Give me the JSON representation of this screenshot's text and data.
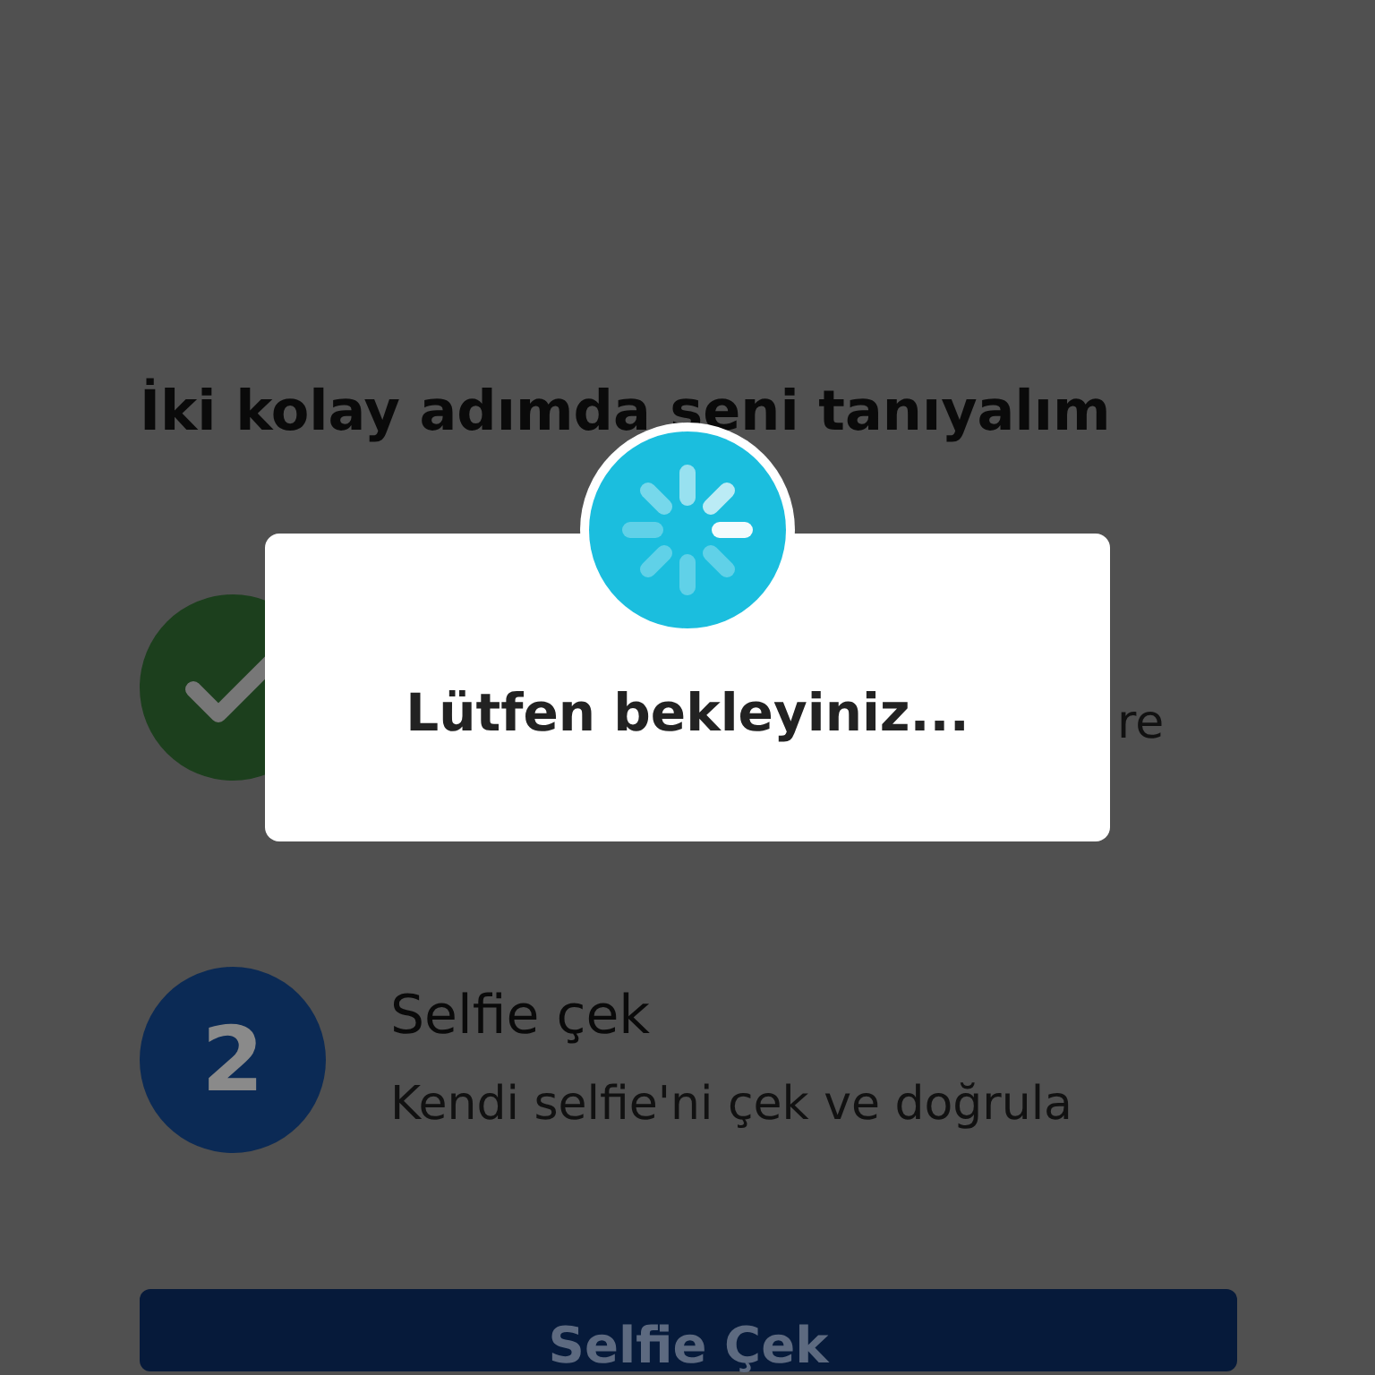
{
  "heading": "İki kolay adımda seni tanıyalım",
  "steps": [
    {
      "kind": "done",
      "description": "re"
    },
    {
      "kind": "number",
      "number": "2",
      "title": "Selfie çek",
      "description": "Kendi selfie'ni çek ve doğrula"
    }
  ],
  "button": {
    "label": "Selfie Çek"
  },
  "dialog": {
    "message": "Lütfen bekleyiniz..."
  }
}
